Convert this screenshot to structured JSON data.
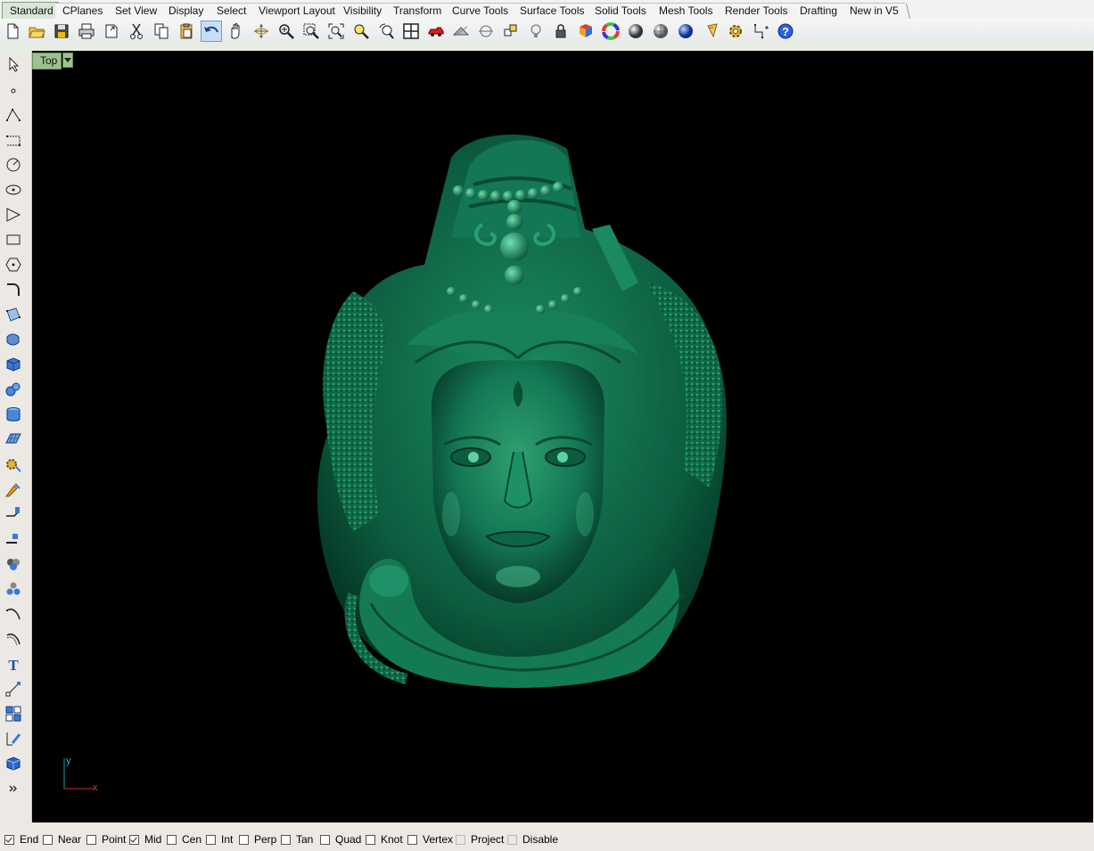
{
  "tabs": [
    {
      "label": "Standard",
      "active": true
    },
    {
      "label": "CPlanes"
    },
    {
      "label": "Set View"
    },
    {
      "label": "Display"
    },
    {
      "label": "Select"
    },
    {
      "label": "Viewport Layout"
    },
    {
      "label": "Visibility"
    },
    {
      "label": "Transform"
    },
    {
      "label": "Curve Tools"
    },
    {
      "label": "Surface Tools"
    },
    {
      "label": "Solid Tools"
    },
    {
      "label": "Mesh Tools"
    },
    {
      "label": "Render Tools"
    },
    {
      "label": "Drafting"
    },
    {
      "label": "New in V5"
    }
  ],
  "toolbar_icons": [
    "new-file-icon",
    "open-folder-icon",
    "save-icon",
    "print-icon",
    "import-icon",
    "cut-icon",
    "copy-icon",
    "paste-icon",
    "undo-icon",
    "pan-hand-icon",
    "rotate-view-icon",
    "zoom-icon",
    "zoom-window-icon",
    "zoom-extents-icon",
    "zoom-selected-icon",
    "undo-view-icon",
    "viewport-layout-icon",
    "car-icon",
    "hide-objects-icon",
    "show-objects-icon",
    "layers-icon",
    "light-bulb-icon",
    "lock-icon",
    "material-icon",
    "color-wheel-icon",
    "shaded-sphere-icon",
    "rendered-sphere-icon",
    "blue-sphere-icon",
    "render-icon",
    "settings-gear-icon",
    "dimension-icon",
    "help-icon"
  ],
  "left_icons": [
    "select-arrow-icon",
    "point-icon",
    "polyline-icon",
    "curve-icon",
    "circle-icon",
    "ellipse-icon",
    "arc-icon",
    "rectangle-icon",
    "polygon-icon",
    "fillet-icon",
    "surface-icon",
    "extrude-icon",
    "box-icon",
    "sphere-icon",
    "cylinder-icon",
    "plane-surface-icon",
    "gear-icon",
    "boolean-icon",
    "split-icon",
    "trim-icon",
    "join-icon",
    "explode-icon",
    "curve-from-object-icon",
    "offset-icon",
    "text-icon",
    "transform-icon",
    "array-icon",
    "analyze-icon",
    "solid-box-icon",
    "expand-icon"
  ],
  "viewport": {
    "label": "Top",
    "axis_y": "y",
    "axis_x": "x",
    "model_color": "#0e6a4a"
  },
  "osnaps": [
    {
      "label": "End",
      "checked": true
    },
    {
      "label": "Near",
      "checked": false
    },
    {
      "label": "Point",
      "checked": false
    },
    {
      "label": "Mid",
      "checked": true
    },
    {
      "label": "Cen",
      "checked": false
    },
    {
      "label": "Int",
      "checked": false
    },
    {
      "label": "Perp",
      "checked": false
    },
    {
      "label": "Tan",
      "checked": false
    },
    {
      "label": "Quad",
      "checked": false
    },
    {
      "label": "Knot",
      "checked": false
    },
    {
      "label": "Vertex",
      "checked": false
    },
    {
      "label": "Project",
      "checked": false,
      "disabled": true
    },
    {
      "label": "Disable",
      "checked": false,
      "disabled": true
    }
  ]
}
